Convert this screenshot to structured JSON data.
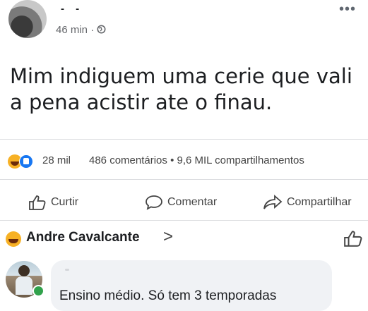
{
  "post": {
    "author_name": "- -",
    "time": "46 min ·",
    "text": "Mim indiguem uma cerie que vali a pena acistir ate o finau.",
    "more_label": "•••"
  },
  "stats": {
    "reactions_count": "28 mil",
    "comments_shares": "486 comentários • 9,6 MIL compartilhamentos"
  },
  "actions": {
    "like": "Curtir",
    "comment": "Comentar",
    "share": "Compartilhar"
  },
  "top_comment_header": {
    "name": "Andre Cavalcante",
    "chevron": ">"
  },
  "comment": {
    "text": "Ensino médio. Só tem 3 temporadas",
    "online_color": "#31a24c"
  },
  "colors": {
    "like_blue": "#1877f2",
    "haha_yellow": "#f7b125",
    "secondary_text": "#65676b"
  }
}
